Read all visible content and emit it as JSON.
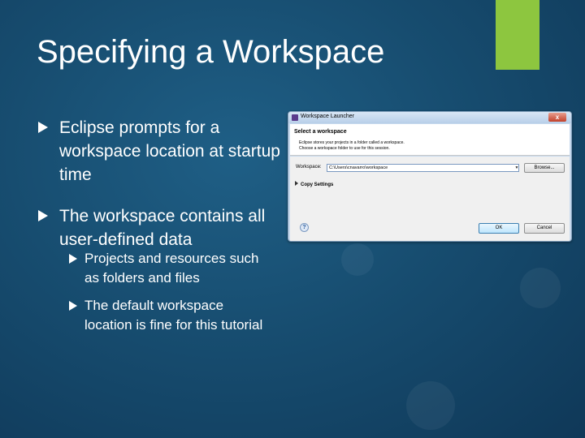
{
  "slide": {
    "title": "Specifying a Workspace",
    "accent_color": "#8dc63f",
    "bullets": [
      {
        "text": "Eclipse prompts for a workspace location at startup time"
      },
      {
        "text": "The workspace contains all user-defined data"
      }
    ],
    "sub_bullets": [
      {
        "text": "Projects and resources such as folders and files"
      },
      {
        "text": "The default workspace location is fine for this tutorial"
      }
    ]
  },
  "dialog": {
    "title": "Workspace Launcher",
    "close_glyph": "x",
    "header_title": "Select a workspace",
    "header_desc_1": "Eclipse stores your projects in a folder called a workspace.",
    "header_desc_2": "Choose a workspace folder to use for this session.",
    "workspace_label": "Workspace:",
    "workspace_value": "C:\\Users\\cnavarro\\workspace",
    "browse_label": "Browse...",
    "copy_settings_label": "Copy Settings",
    "help_glyph": "?",
    "ok_label": "OK",
    "cancel_label": "Cancel"
  }
}
